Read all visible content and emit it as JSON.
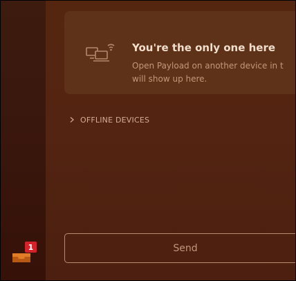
{
  "empty_state": {
    "title": "You're the only one here",
    "subtitle_line1": "Open Payload on another device in t",
    "subtitle_line2": "will show up here.",
    "icon": "devices-wifi-icon"
  },
  "offline_devices": {
    "label": "OFFLINE DEVICES",
    "icon": "chevron-right-icon"
  },
  "send_button": {
    "label": "Send"
  },
  "sidebar": {
    "inbox_icon": "inbox-tray-icon",
    "badge_count": "1"
  },
  "colors": {
    "accent": "#d3222b",
    "icon_orange": "#e17e27"
  }
}
